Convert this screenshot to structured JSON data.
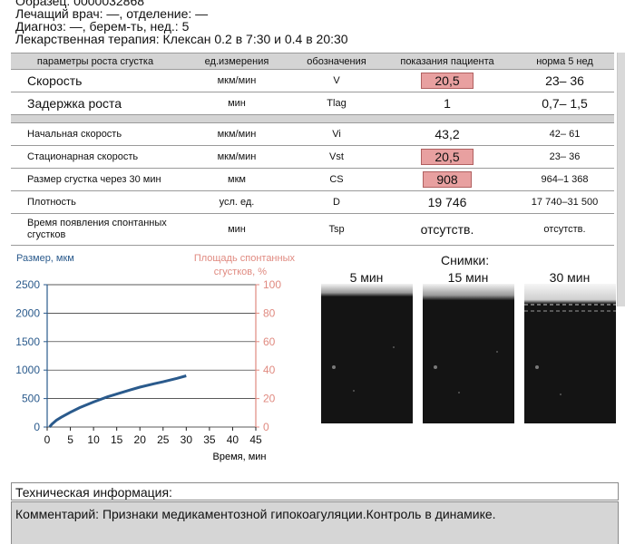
{
  "header": {
    "line1": "Образец: 0000032868",
    "line2": "Лечащий врач: —, отделение: —",
    "line3": "Диагноз: —, берем-ть, нед.: 5",
    "line4": "Лекарственная терапия: Клексан 0.2 в 7:30 и 0.4 в 20:30"
  },
  "table": {
    "headers": [
      "параметры роста сгустка",
      "ед.измерения",
      "обозначения",
      "показания пациента",
      "норма 5 нед"
    ],
    "rows_top": [
      {
        "name": "Скорость",
        "unit": "мкм/мин",
        "symbol": "V",
        "value": "20,5",
        "norm": "23– 36",
        "flag": true
      },
      {
        "name": "Задержка роста",
        "unit": "мин",
        "symbol": "Tlag",
        "value": "1",
        "norm": "0,7– 1,5",
        "flag": false
      }
    ],
    "rows_bottom": [
      {
        "name": "Начальная скорость",
        "unit": "мкм/мин",
        "symbol": "Vi",
        "value": "43,2",
        "norm": "42– 61",
        "flag": false
      },
      {
        "name": "Стационарная скорость",
        "unit": "мкм/мин",
        "symbol": "Vst",
        "value": "20,5",
        "norm": "23– 36",
        "flag": true
      },
      {
        "name": "Размер сгустка через 30 мин",
        "unit": "мкм",
        "symbol": "CS",
        "value": "908",
        "norm": "964–1 368",
        "flag": true
      },
      {
        "name": "Плотность",
        "unit": "усл. ед.",
        "symbol": "D",
        "value": "19 746",
        "norm": "17 740–31 500",
        "flag": false
      },
      {
        "name": "Время появления спонтанных сгустков",
        "unit": "мин",
        "symbol": "Tsp",
        "value": "отсутств.",
        "norm": "отсутств.",
        "flag": false
      }
    ]
  },
  "chart_data": {
    "type": "line",
    "title": "",
    "xlabel": "Время, мин",
    "ylabel": "Размер, мкм",
    "ylabel_right": "Площадь спонтанных сгустков, %",
    "xlim": [
      0,
      45
    ],
    "ylim": [
      0,
      2500
    ],
    "ylim_right": [
      0,
      100
    ],
    "x_ticks": [
      "0",
      "5",
      "10",
      "15",
      "20",
      "25",
      "30",
      "35",
      "40",
      "45"
    ],
    "y_ticks": [
      "0",
      "500",
      "1000",
      "1500",
      "2000",
      "2500"
    ],
    "y_ticks_right": [
      "0",
      "20",
      "40",
      "60",
      "80",
      "100"
    ],
    "grid": true,
    "series": [
      {
        "color": "#2a5a8c",
        "x": [
          0.5,
          1,
          2,
          3,
          5,
          7,
          10,
          13,
          15,
          18,
          20,
          23,
          25,
          28,
          30
        ],
        "y": [
          0,
          50,
          120,
          170,
          260,
          340,
          440,
          530,
          580,
          655,
          700,
          760,
          795,
          855,
          900
        ]
      }
    ]
  },
  "snapshots": {
    "title": "Снимки:",
    "labels": [
      "5 мин",
      "15 мин",
      "30 мин"
    ]
  },
  "tech": {
    "label": "Техническая информация:"
  },
  "comment": {
    "text": "Комментарий: Признаки медикаментозной гипокоагуляции.Контроль в динамике."
  }
}
